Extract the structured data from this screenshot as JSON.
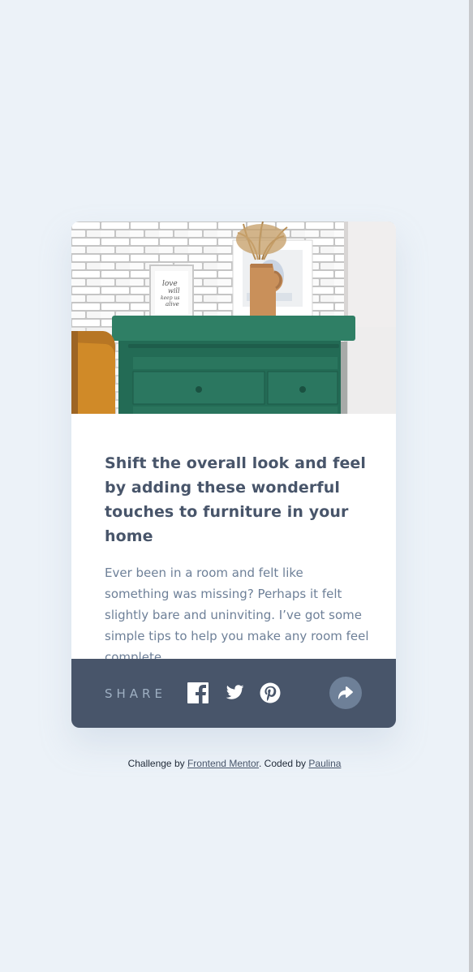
{
  "card": {
    "title": "Shift the overall look and feel by adding these wonderful touches to furniture in your home",
    "description": "Ever been in a room and felt like something was missing? Perhaps it felt slightly bare and uninviting. I’ve got some simple tips to help you make any room feel complete.",
    "image_frame_text": [
      "love",
      "will",
      "keep us",
      "alive"
    ]
  },
  "share": {
    "label": "SHARE",
    "icons": [
      "facebook-icon",
      "twitter-icon",
      "pinterest-icon",
      "share-arrow-icon"
    ]
  },
  "attribution": {
    "prefix": "Challenge by ",
    "frontend_mentor_link": "Frontend Mentor",
    "middle": ". Coded by ",
    "author_link": "Paulina"
  },
  "colors": {
    "page_background": "#ecf2f8",
    "card_background": "#ffffff",
    "title": "#48556a",
    "description": "#6e8098",
    "share_bar": "#48556a",
    "share_label": "#9eafc2",
    "share_button": "#6e8098"
  }
}
